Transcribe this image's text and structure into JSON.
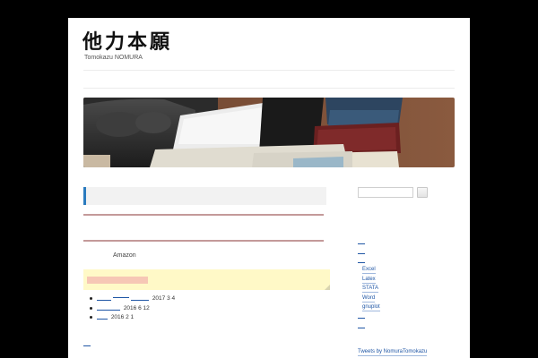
{
  "site": {
    "title": "他力本願",
    "description": "Tomokazu NOMURA"
  },
  "main": {
    "amazon_label": "Amazon",
    "recent_posts": [
      {
        "date": "2017 3 4"
      },
      {
        "date": "2016 6 12"
      },
      {
        "date": "2016 2 1"
      }
    ]
  },
  "sidebar": {
    "search": {
      "value": ""
    },
    "categories": [
      "Excel",
      "Latex",
      "STATA",
      "Word",
      "gnuplot"
    ],
    "twitter_link": "Tweets by NomuraTomokazu"
  },
  "colors": {
    "accent_blue": "#2b7bbf",
    "link_blue": "#1f56a5",
    "rule_red": "#c49a9a",
    "note_yellow": "#fff9c7"
  }
}
